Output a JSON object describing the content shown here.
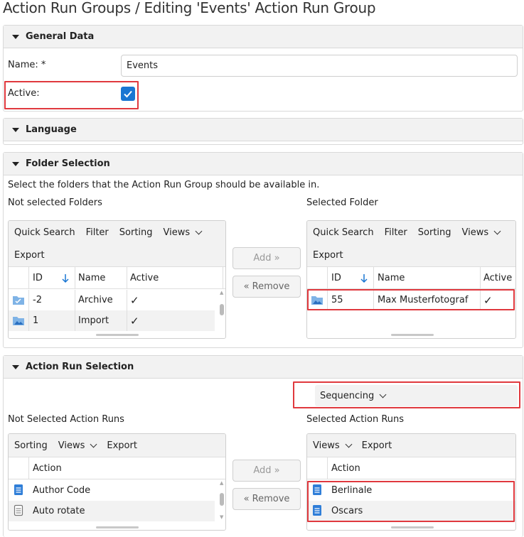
{
  "page_title": "Action Run Groups / Editing 'Events' Action Run Group",
  "general": {
    "header": "General Data",
    "name_label": "Name: *",
    "name_value": "Events",
    "active_label": "Active:",
    "active_checked": true
  },
  "language": {
    "header": "Language"
  },
  "folders": {
    "header": "Folder Selection",
    "description": "Select the folders that the Action Run Group should be available in.",
    "left_title": "Not selected Folders",
    "right_title": "Selected Folder",
    "toolbar": {
      "quick_search": "Quick Search",
      "filter": "Filter",
      "sorting": "Sorting",
      "views": "Views",
      "export": "Export"
    },
    "columns": {
      "id": "ID",
      "name": "Name",
      "active": "Active"
    },
    "left_rows": [
      {
        "id": "-2",
        "name": "Archive",
        "active": "✓"
      },
      {
        "id": "1",
        "name": "Import",
        "active": "✓"
      }
    ],
    "right_rows": [
      {
        "id": "55",
        "name": "Max Musterfotograf",
        "active": "✓"
      }
    ],
    "add_label": "Add »",
    "remove_label": "« Remove"
  },
  "action_runs": {
    "header": "Action Run Selection",
    "sequencing_label": "Sequencing",
    "left_title": "Not Selected Action Runs",
    "right_title": "Selected Action Runs",
    "toolbar": {
      "sorting": "Sorting",
      "views": "Views",
      "export": "Export"
    },
    "column_action": "Action",
    "left_rows": [
      {
        "action": "Author Code"
      },
      {
        "action": "Auto rotate"
      }
    ],
    "right_rows": [
      {
        "action": "Berlinale"
      },
      {
        "action": "Oscars"
      }
    ],
    "add_label": "Add »",
    "remove_label": "« Remove"
  },
  "colors": {
    "accent": "#1976d2",
    "highlight": "#e0393e",
    "header_bg": "#f2f2f2",
    "border": "#d9d9d9"
  }
}
